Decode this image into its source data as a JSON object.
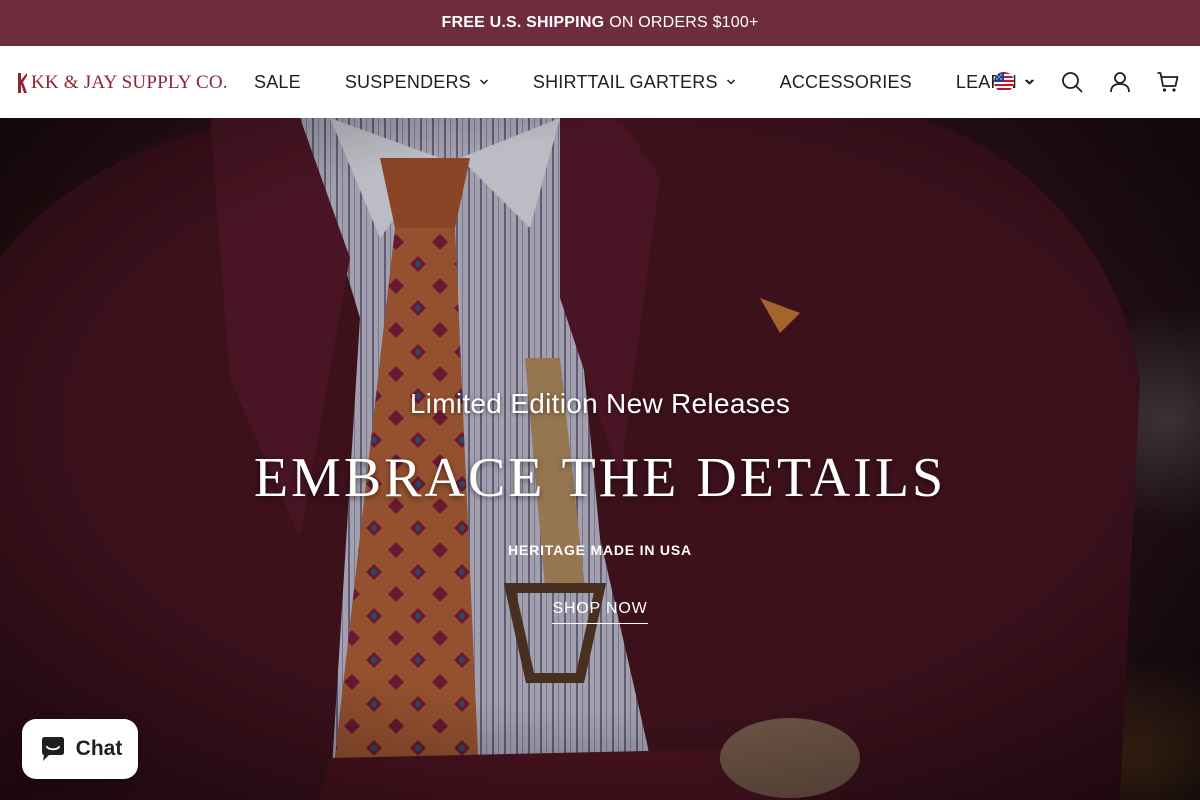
{
  "announcement": {
    "bold": "FREE U.S. SHIPPING",
    "rest": "ON ORDERS $100+"
  },
  "header": {
    "logo_text": "KK & JAY SUPPLY CO.",
    "nav": [
      {
        "label": "SALE",
        "has_dropdown": false
      },
      {
        "label": "SUSPENDERS",
        "has_dropdown": true
      },
      {
        "label": "SHIRTTAIL GARTERS",
        "has_dropdown": true
      },
      {
        "label": "ACCESSORIES",
        "has_dropdown": false
      },
      {
        "label": "LEARN",
        "has_dropdown": true
      }
    ],
    "locale_icon": "us-flag-icon",
    "action_icons": [
      "search-icon",
      "account-icon",
      "cart-icon"
    ]
  },
  "hero": {
    "eyebrow": "Limited Edition New Releases",
    "headline": "EMBRACE THE DETAILS",
    "subheadline": "HERITAGE MADE IN USA",
    "cta_label": "SHOP NOW"
  },
  "chat_widget": {
    "label": "Chat",
    "icon": "chat-bubble-icon"
  },
  "colors": {
    "announcement_bg": "#6e2c3f",
    "logo": "#8c2435",
    "jacket": "#4a1523",
    "tie": "#b5633a"
  }
}
